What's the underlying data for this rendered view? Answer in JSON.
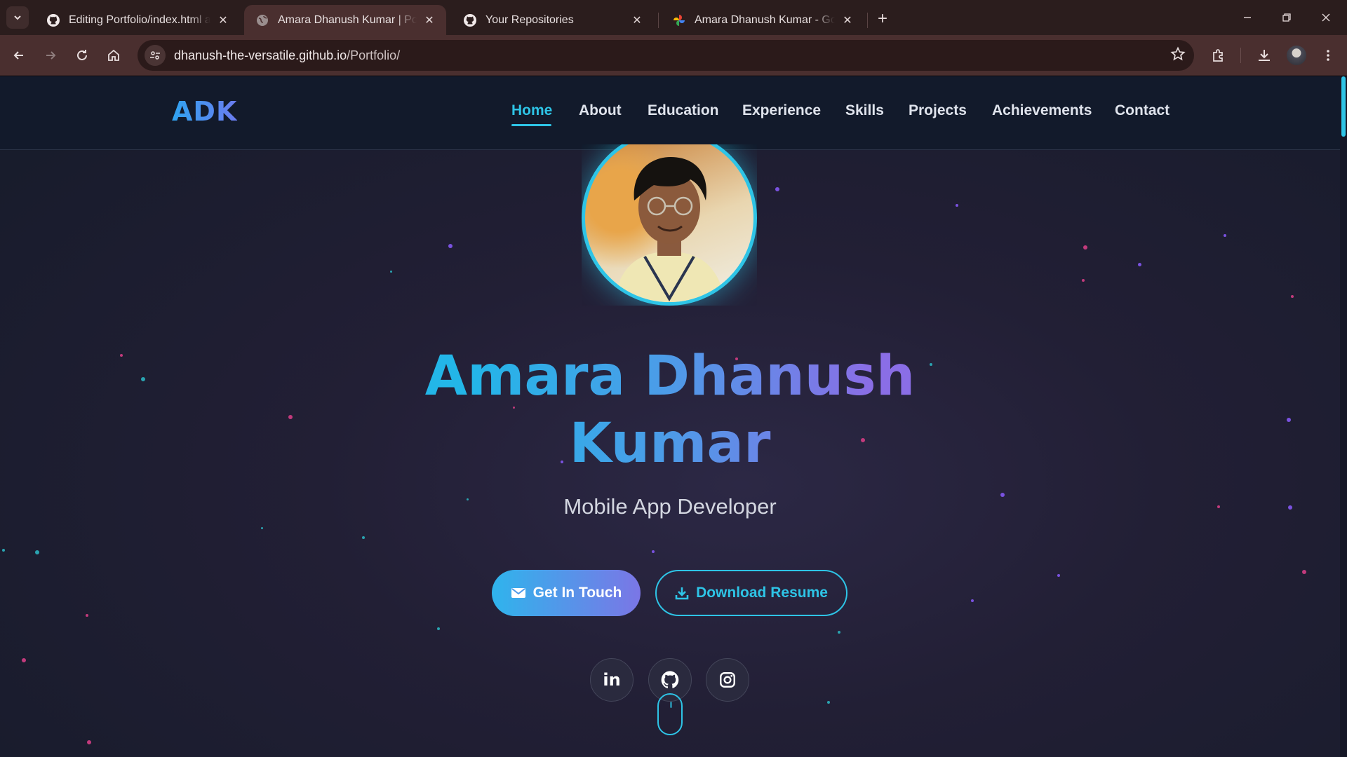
{
  "browser": {
    "tabs": [
      {
        "title": "Editing Portfolio/index.html at m",
        "icon": "github-icon"
      },
      {
        "title": "Amara Dhanush Kumar | Portfolio",
        "icon": "globe-icon",
        "active": true
      },
      {
        "title": "Your Repositories",
        "icon": "github-icon"
      },
      {
        "title": "Amara Dhanush Kumar - Google",
        "icon": "google-photos-icon"
      }
    ],
    "url": {
      "host": "dhanush-the-versatile.github.io",
      "path": "/Portfolio/"
    }
  },
  "site": {
    "logo": "ADK",
    "nav": [
      "Home",
      "About",
      "Education",
      "Experience",
      "Skills",
      "Projects",
      "Achievements",
      "Contact"
    ],
    "active_nav": "Home",
    "hero": {
      "name_line1": "Amara Dhanush",
      "name_line2": "Kumar",
      "subtitle": "Mobile App Developer",
      "primary_button": "Get In Touch",
      "secondary_button": "Download Resume"
    },
    "social": [
      "linkedin-icon",
      "github-icon",
      "instagram-icon"
    ],
    "colors": {
      "accent": "#2ec4e6",
      "gradient_end": "#8a6ee6",
      "nav_bg": "#121a2b"
    }
  }
}
